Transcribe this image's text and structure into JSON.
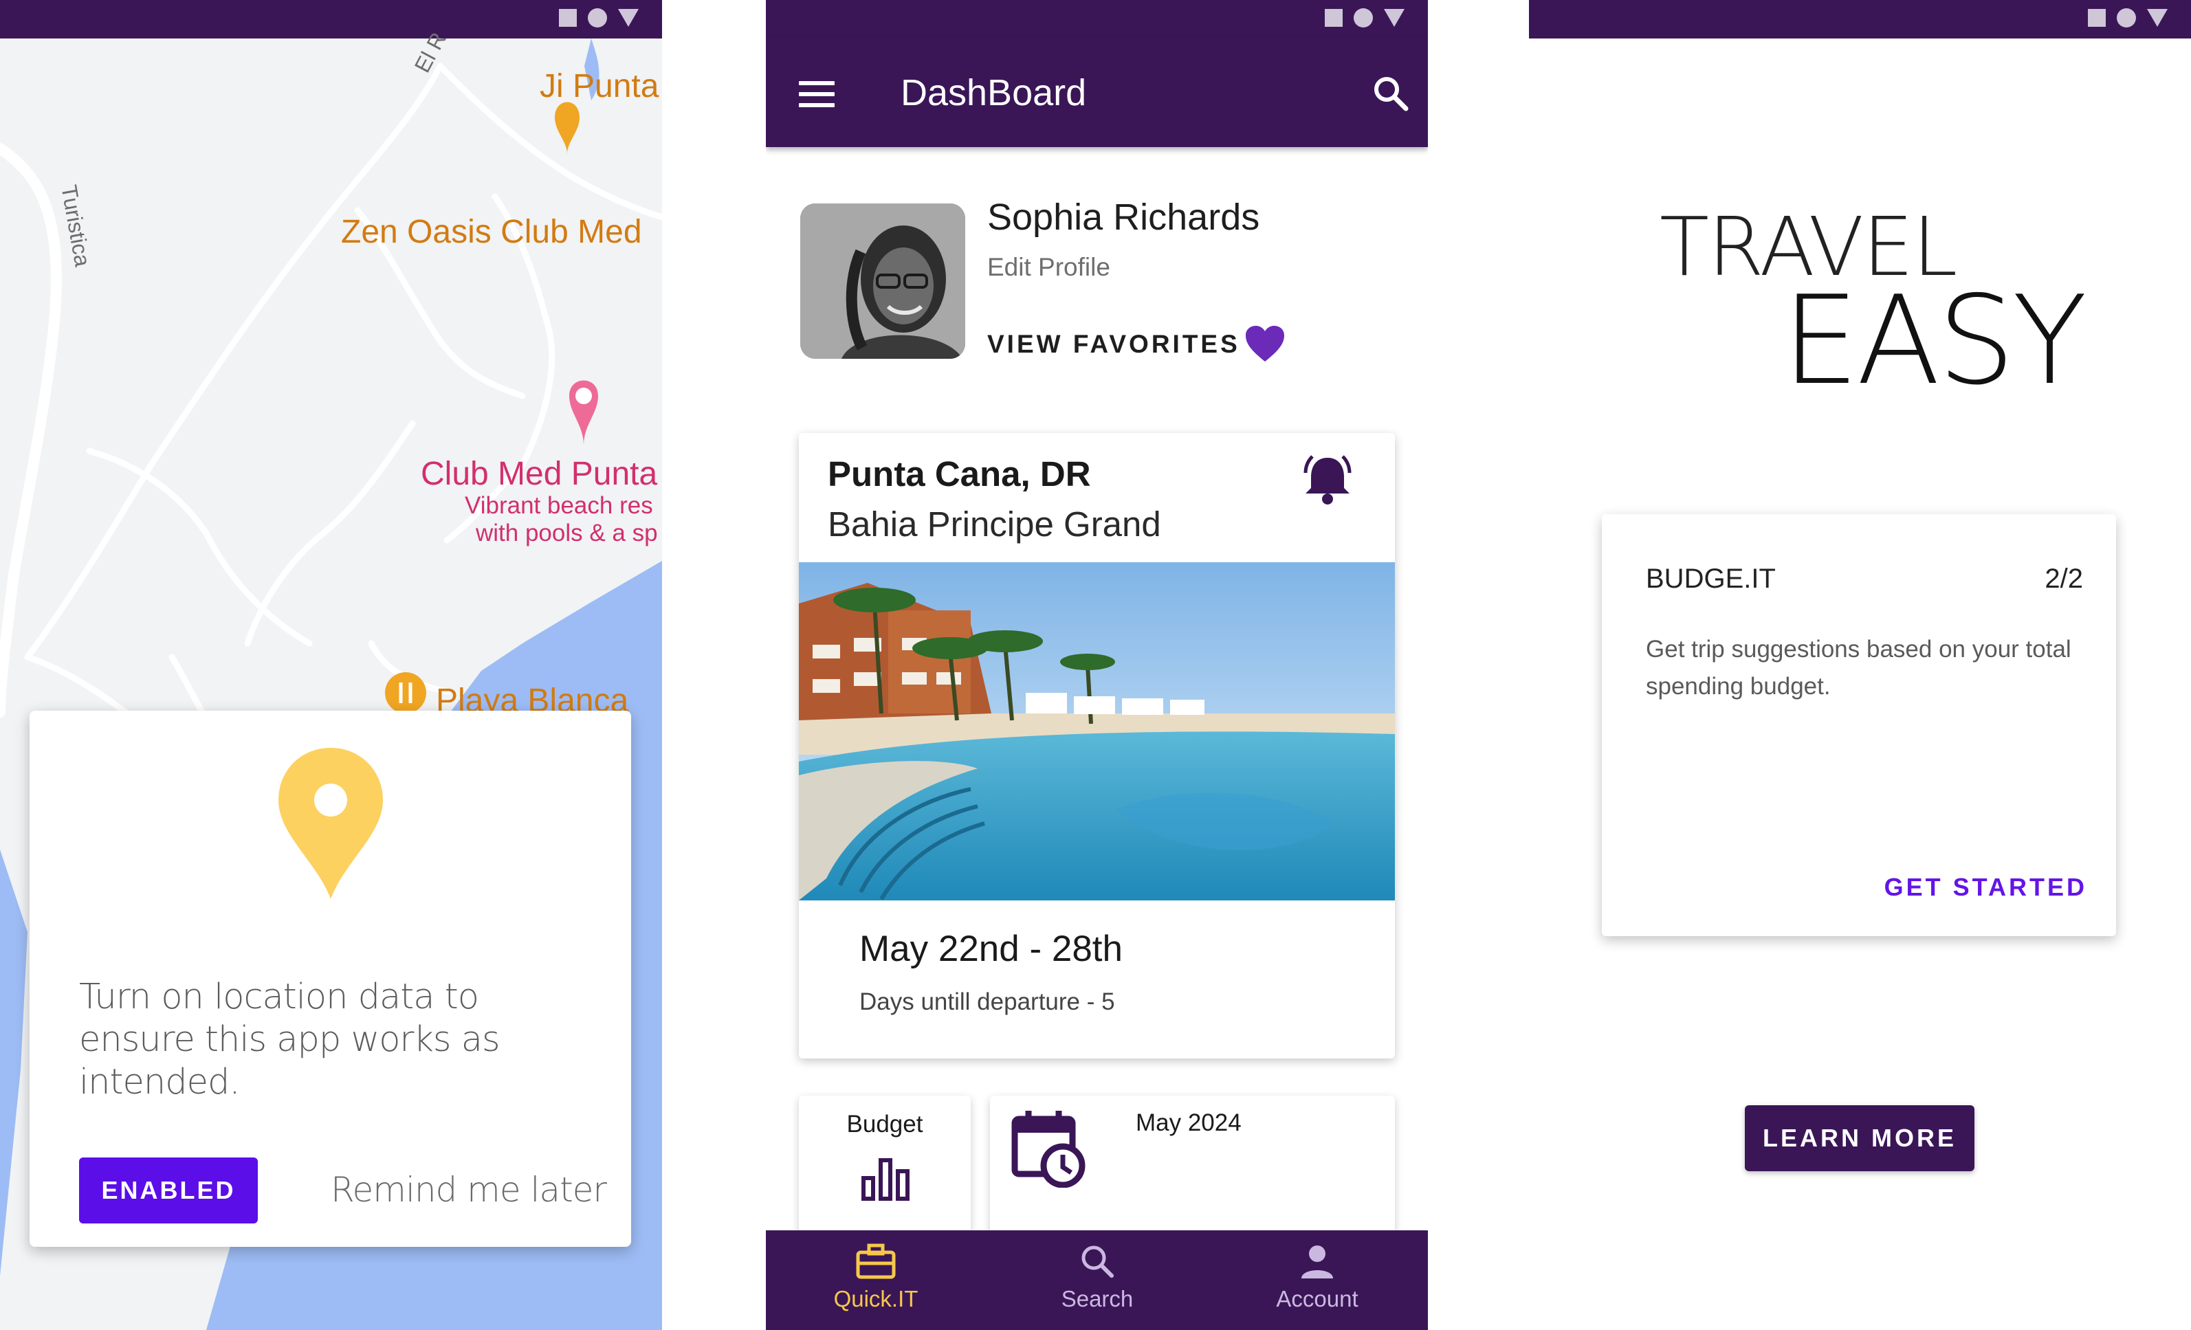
{
  "map_screen": {
    "poi": {
      "ji_punta": "Ji Punta",
      "zen_oasis": "Zen Oasis Club Med",
      "club_med_punta": "Club Med Punta",
      "club_med_desc_1": "Vibrant beach res",
      "club_med_desc_2": "with pools & a sp",
      "playa_blanca": "Playa Blanca",
      "road_el_r": "El R",
      "road_turistica": "Turistica"
    },
    "location_prompt": {
      "message": "Turn on location data to ensure this app works as intended.",
      "enabled_label": "ENABLED",
      "remind_label": "Remind me later"
    }
  },
  "dashboard_screen": {
    "title": "DashBoard",
    "profile": {
      "name": "Sophia Richards",
      "edit_label": "Edit Profile",
      "favorites_label": "VIEW FAVORITES"
    },
    "trip": {
      "location": "Punta Cana, DR",
      "hotel": "Bahia Principe Grand",
      "dates": "May 22nd - 28th",
      "days_until": "Days untill departure - 5"
    },
    "budget_label": "Budget",
    "calendar_month": "May 2024",
    "nav": [
      {
        "label": "Quick.IT",
        "icon": "briefcase-icon",
        "active": true
      },
      {
        "label": "Search",
        "icon": "search-icon",
        "active": false
      },
      {
        "label": "Account",
        "icon": "person-icon",
        "active": false
      }
    ]
  },
  "onboarding_screen": {
    "brand_line_1": "TRAVEL",
    "brand_line_2": "EASY",
    "feature": {
      "title": "BUDGE.IT",
      "counter": "2/2",
      "description": "Get trip suggestions based on your total spending budget.",
      "cta": "GET STARTED"
    },
    "learn_more_label": "LEARN MORE"
  },
  "colors": {
    "primary": "#3a1657",
    "accent": "#5b0ee8",
    "nav_active": "#f5c84a",
    "location_pin": "#fcd15f",
    "map_water": "#9dbcf5"
  }
}
